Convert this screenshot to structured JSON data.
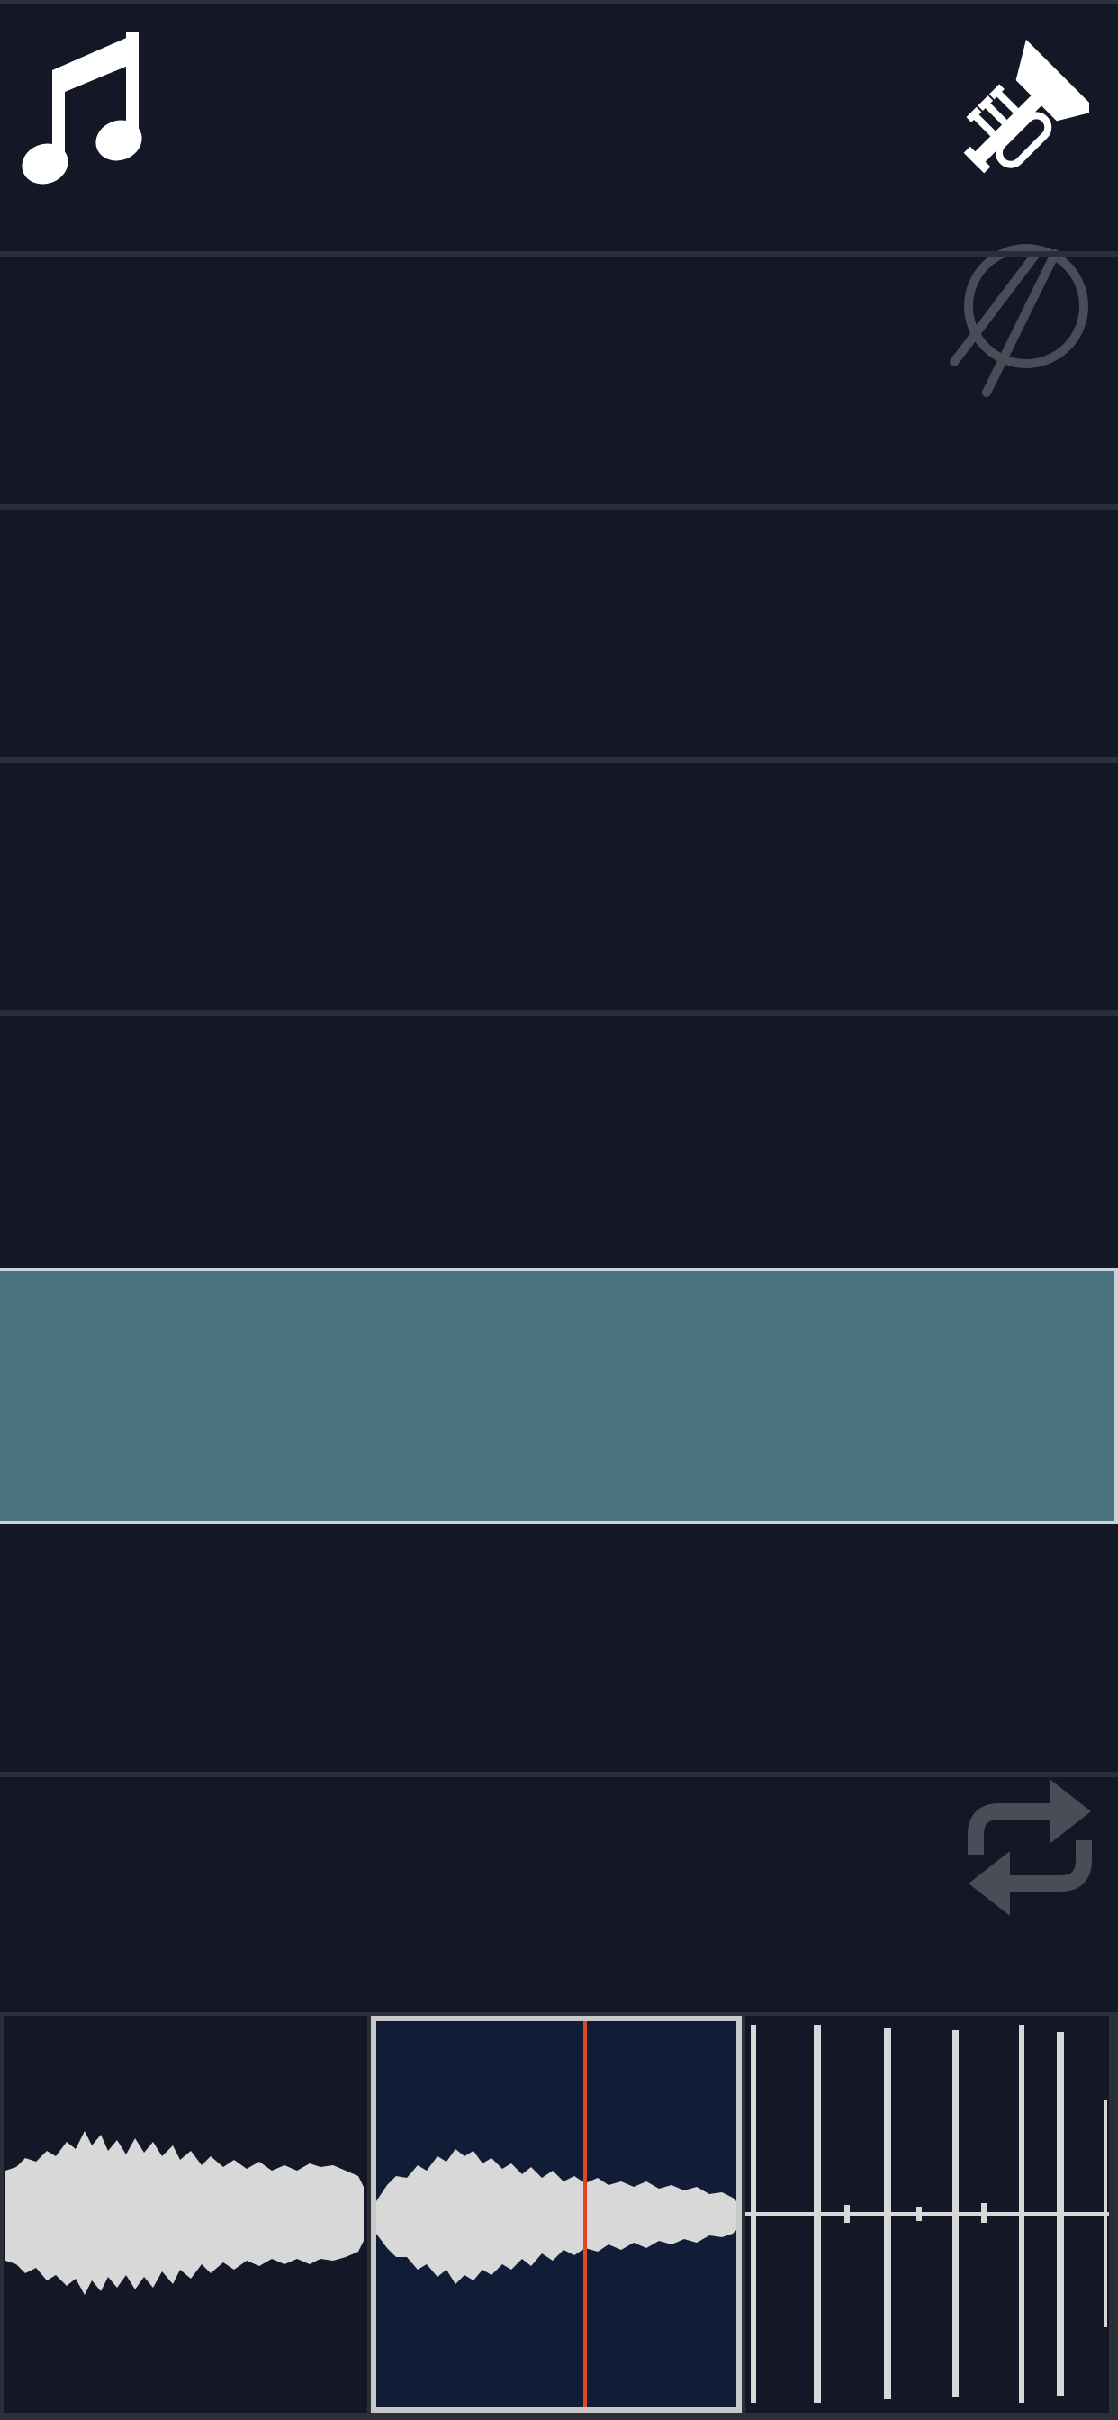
{
  "colors": {
    "background": "#131726",
    "lane_divider": "#2a2e3b",
    "selected_lane": "#48737f",
    "selected_border": "#c9d4d8",
    "active_clip_bg": "#111d37",
    "waveform": "#d8d8d8",
    "playhead": "#e2481f",
    "dimmed_icon": "#4a4d57"
  },
  "icons": {
    "music_note": "music-note-icon",
    "trumpet": "trumpet-icon",
    "drumstick": "drumstick-circle-icon",
    "loop": "loop-icon"
  },
  "tracks": [
    {
      "id": "lane-1",
      "selected": false
    },
    {
      "id": "lane-2",
      "selected": false
    },
    {
      "id": "lane-3",
      "selected": false
    },
    {
      "id": "lane-4",
      "selected": false
    },
    {
      "id": "lane-5",
      "selected": true
    },
    {
      "id": "lane-6",
      "selected": false
    },
    {
      "id": "lane-7",
      "selected": false
    }
  ],
  "clips": [
    {
      "id": "clip-1",
      "waveform": "sustained",
      "active": false
    },
    {
      "id": "clip-2",
      "waveform": "sustained",
      "active": true,
      "playhead": 0.57
    },
    {
      "id": "clip-3",
      "waveform": "percussive",
      "active": false
    }
  ]
}
